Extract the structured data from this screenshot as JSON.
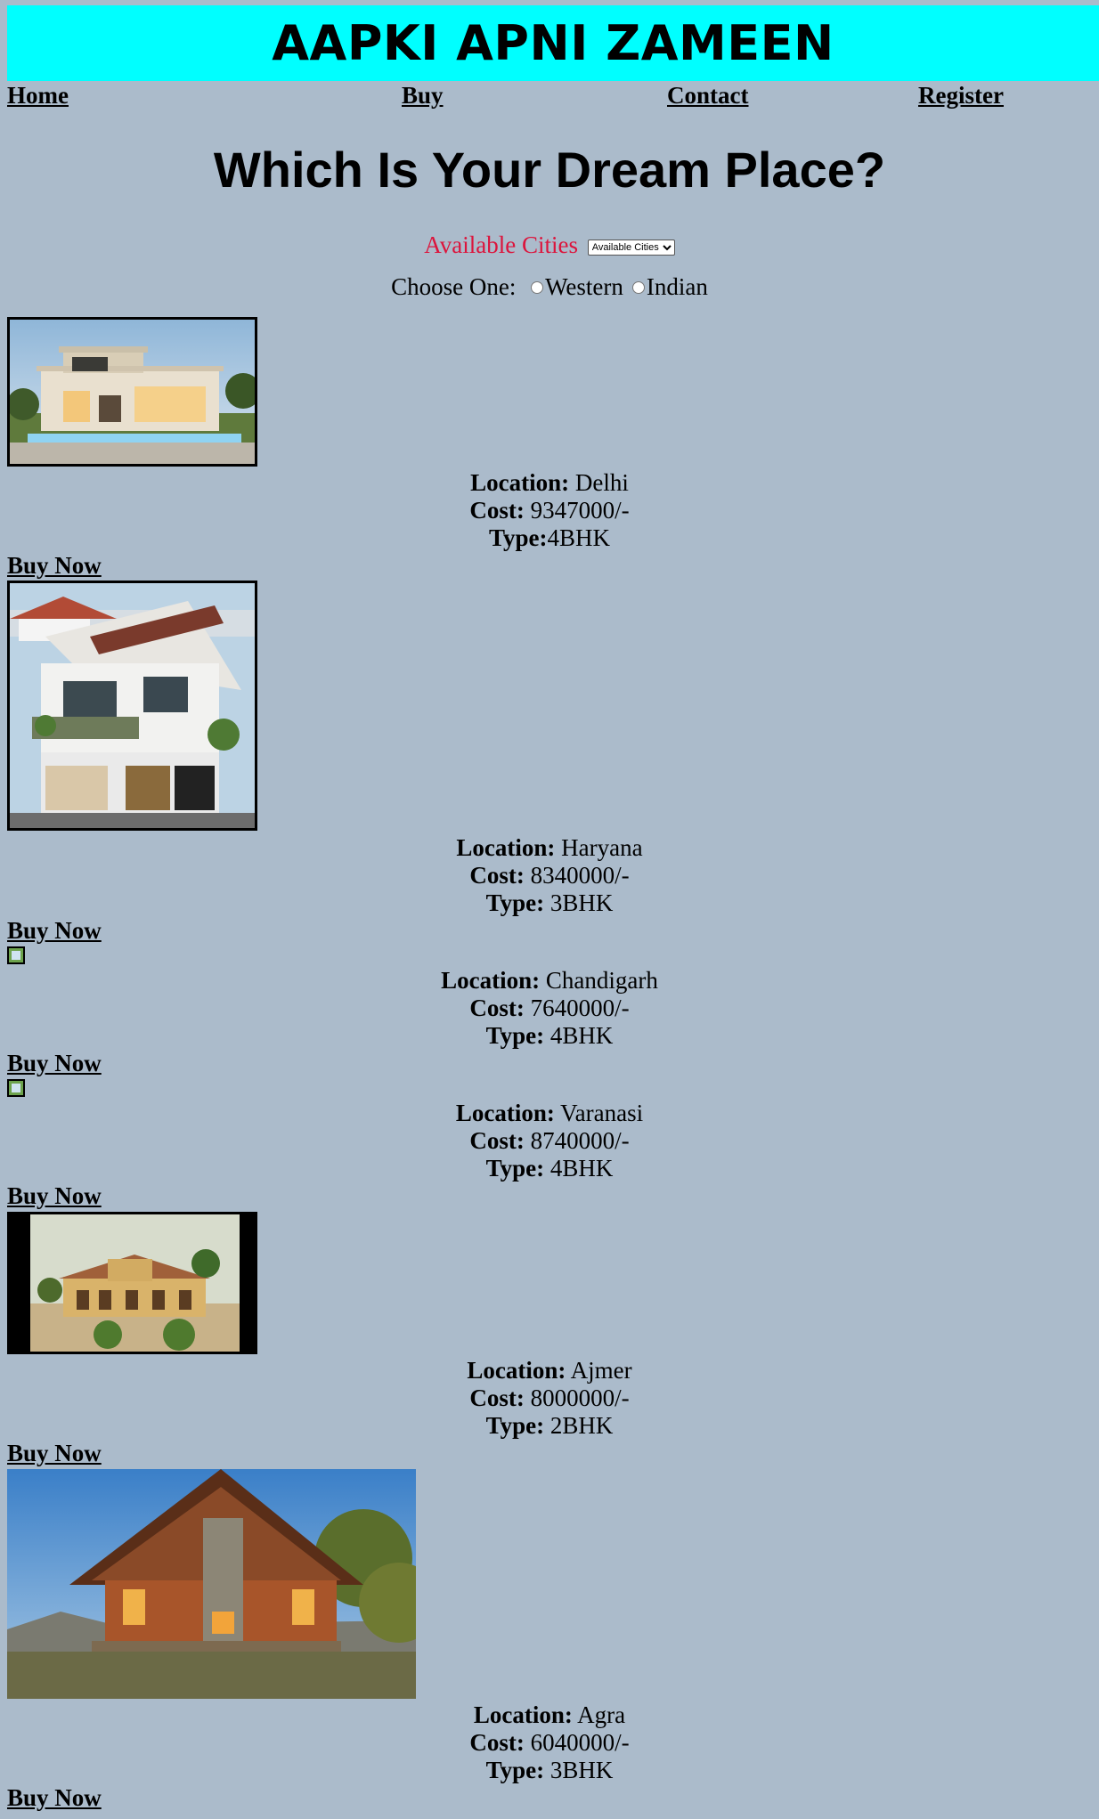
{
  "header": {
    "title": "AAPKI APNI ZAMEEN"
  },
  "nav": {
    "home": "Home",
    "buy": "Buy",
    "contact": "Contact",
    "register": "Register"
  },
  "heading": "Which Is Your Dream Place?",
  "cities": {
    "label": "Available Cities",
    "selected": "Available Cities"
  },
  "choose": {
    "label": "Choose One:",
    "options": [
      "Western",
      "Indian"
    ]
  },
  "listing_labels": {
    "location": "Location:",
    "cost": "Cost:",
    "type": "Type:"
  },
  "buy_now": "Buy Now",
  "listings": [
    {
      "location": "Delhi",
      "cost": "9347000/-",
      "type": "4BHK"
    },
    {
      "location": "Haryana",
      "cost": "8340000/-",
      "type": "3BHK"
    },
    {
      "location": "Chandigarh",
      "cost": "7640000/-",
      "type": "4BHK"
    },
    {
      "location": "Varanasi",
      "cost": "8740000/-",
      "type": "4BHK"
    },
    {
      "location": "Ajmer",
      "cost": "8000000/-",
      "type": "2BHK"
    },
    {
      "location": "Agra",
      "cost": "6040000/-",
      "type": "3BHK"
    }
  ],
  "colors": {
    "background": "#abbbcb",
    "banner": "#00ffff",
    "cities_label": "#dc143c"
  }
}
